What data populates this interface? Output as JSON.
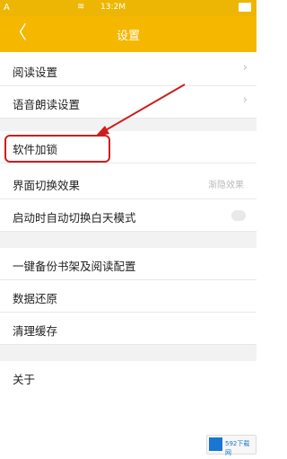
{
  "status_bar": {
    "left_glyph": "A",
    "time": "13:2M",
    "wifi_glyph": "≋"
  },
  "nav": {
    "back_glyph": "〈",
    "title": "设置"
  },
  "sections": [
    {
      "items": [
        {
          "label": "阅读设置",
          "accessory": "chevron"
        },
        {
          "label": "语音朗读设置",
          "accessory": "chevron"
        }
      ]
    },
    {
      "items": [
        {
          "label": "软件加锁",
          "accessory": "none"
        },
        {
          "label": "界面切换效果",
          "accessory": "value",
          "value": "渐隐效果"
        },
        {
          "label": "启动时自动切换白天模式",
          "accessory": "toggle"
        }
      ]
    },
    {
      "items": [
        {
          "label": "一键备份书架及阅读配置",
          "accessory": "none"
        },
        {
          "label": "数据还原",
          "accessory": "none"
        },
        {
          "label": "清理缓存",
          "accessory": "none"
        }
      ]
    },
    {
      "items": [
        {
          "label": "关于",
          "accessory": "none"
        }
      ]
    }
  ],
  "chevron_glyph": "›",
  "watermark_text": "592下载网",
  "colors": {
    "accent": "#f5b700",
    "highlight": "#cc1e1e"
  }
}
